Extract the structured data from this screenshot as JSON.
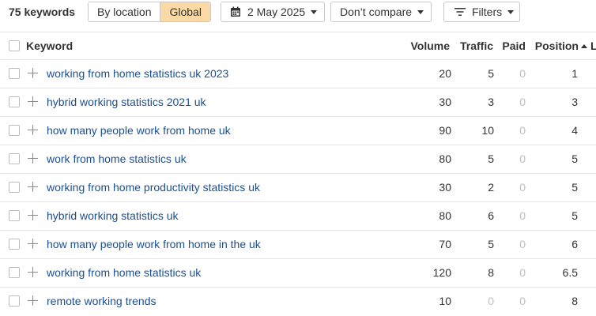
{
  "toolbar": {
    "keyword_count": "75 keywords",
    "by_location_label": "By location",
    "global_label": "Global",
    "date_label": "2 May 2025",
    "compare_label": "Don’t compare",
    "filters_label": "Filters",
    "accent_color": "#fbd9a4"
  },
  "table": {
    "headers": {
      "keyword": "Keyword",
      "volume": "Volume",
      "traffic": "Traffic",
      "paid": "Paid",
      "position": "Position",
      "next": "L"
    },
    "rows": [
      {
        "keyword": "working from home statistics uk 2023",
        "volume": "20",
        "traffic": "5",
        "paid": "0",
        "position": "1"
      },
      {
        "keyword": "hybrid working statistics 2021 uk",
        "volume": "30",
        "traffic": "3",
        "paid": "0",
        "position": "3"
      },
      {
        "keyword": "how many people work from home uk",
        "volume": "90",
        "traffic": "10",
        "paid": "0",
        "position": "4"
      },
      {
        "keyword": "work from home statistics uk",
        "volume": "80",
        "traffic": "5",
        "paid": "0",
        "position": "5"
      },
      {
        "keyword": "working from home productivity statistics uk",
        "volume": "30",
        "traffic": "2",
        "paid": "0",
        "position": "5"
      },
      {
        "keyword": "hybrid working statistics uk",
        "volume": "80",
        "traffic": "6",
        "paid": "0",
        "position": "5"
      },
      {
        "keyword": "how many people work from home in the uk",
        "volume": "70",
        "traffic": "5",
        "paid": "0",
        "position": "6"
      },
      {
        "keyword": "working from home statistics uk",
        "volume": "120",
        "traffic": "8",
        "paid": "0",
        "position": "6.5"
      },
      {
        "keyword": "remote working trends",
        "volume": "10",
        "traffic": "0",
        "paid": "0",
        "position": "8"
      }
    ]
  }
}
